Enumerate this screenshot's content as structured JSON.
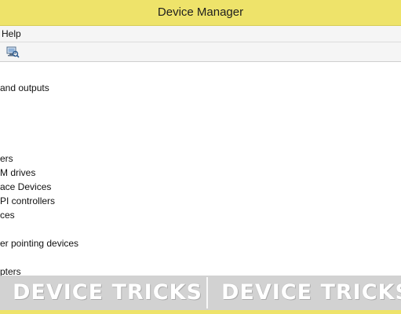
{
  "window": {
    "title": "Device Manager"
  },
  "menu": {
    "items": [
      "Help"
    ]
  },
  "toolbar": {
    "buttons": [
      {
        "icon": "scan-hardware-icon"
      }
    ]
  },
  "tree": {
    "items": [
      {
        "label": "and outputs"
      },
      {
        "label": "ers"
      },
      {
        "label": "M drives"
      },
      {
        "label": "ace Devices"
      },
      {
        "label": "PI controllers"
      },
      {
        "label": "ces"
      },
      {
        "label": "er pointing devices"
      },
      {
        "label": "pters"
      }
    ]
  },
  "watermark": {
    "left_text": "DEVICE TRICKS",
    "right_text": "DEVICE TRICKS"
  },
  "colors": {
    "title_bar": "#eee36a",
    "menu_bg": "#f5f5f5",
    "watermark_band": "#cfcfcf"
  }
}
